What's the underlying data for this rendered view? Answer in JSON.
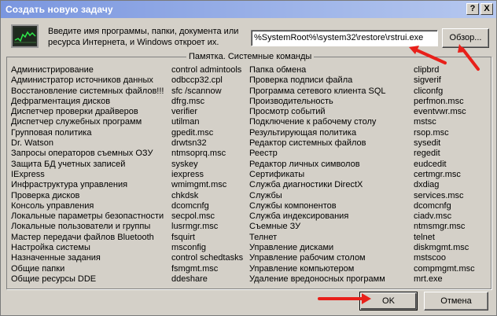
{
  "window": {
    "title": "Создать новую задачу",
    "help_label": "?",
    "close_label": "X",
    "prompt": "Введите имя программы, папки, документа или ресурса Интернета, и Windows откроет их.",
    "command_value": "%SystemRoot%\\system32\\restore\\rstrui.exe",
    "browse_label": "Обзор...",
    "ok_label": "OK",
    "cancel_label": "Отмена",
    "annotation_color": "#e8201a"
  },
  "memo": {
    "title": "Памятка. Системные команды",
    "col1": [
      "Администрирование",
      "Администратор источников данных",
      "Восстановление системных файлов!!!",
      "Дефрагментация дисков",
      "Диспетчер проверки драйверов",
      "Диспетчер служебных программ",
      "Групповая политика",
      "Dr. Watson",
      "Запросы операторов съемных ОЗУ",
      "Защита БД учетных записей",
      "IExpress",
      "Инфраструктура управления",
      "Проверка дисков",
      "Консоль управления",
      "Локальные параметры безопастности",
      "Локальные пользователи и группы",
      "Мастер передачи файлов Bluetooth",
      "Настройка системы",
      "Назначенные задания",
      "Общие папки",
      "Общие ресурсы DDE"
    ],
    "col2": [
      "control admintools",
      "odbccp32.cpl",
      "sfc /scannow",
      "dfrg.msc",
      "verifier",
      "utilman",
      "gpedit.msc",
      "drwtsn32",
      "ntmsoprq.msc",
      "syskey",
      "iexpress",
      "wmimgmt.msc",
      "chkdsk",
      "dcomcnfg",
      "secpol.msc",
      "lusrmgr.msc",
      "fsquirt",
      "msconfig",
      "control schedtasks",
      "fsmgmt.msc",
      "ddeshare"
    ],
    "col3": [
      "Папка обмена",
      "Проверка подписи файла",
      "Программа сетевого клиента SQL",
      "Производительность",
      "Просмотр событий",
      "Подключение к рабочему столу",
      "Результирующая политика",
      "Редактор системных файлов",
      "Реестр",
      "Редактор личных символов",
      "Сертификаты",
      "Служба диагностики DirectX",
      "Службы",
      "Службы компонентов",
      "Служба индексирования",
      "Съемные ЗУ",
      "Телнет",
      "Управление дисками",
      "Управление рабочим столом",
      "Управление компьютером",
      "Удаление вредоносных программ"
    ],
    "col4": [
      "clipbrd",
      "sigverif",
      "cliconfg",
      "perfmon.msc",
      "eventvwr.msc",
      "mstsc",
      "rsop.msc",
      "sysedit",
      "regedit",
      "eudcedit",
      "certmgr.msc",
      "dxdiag",
      "services.msc",
      "dcomcnfg",
      "ciadv.msc",
      "ntmsmgr.msc",
      "telnet",
      "diskmgmt.msc",
      "mstscoo",
      "compmgmt.msc",
      "mrt.exe"
    ]
  }
}
